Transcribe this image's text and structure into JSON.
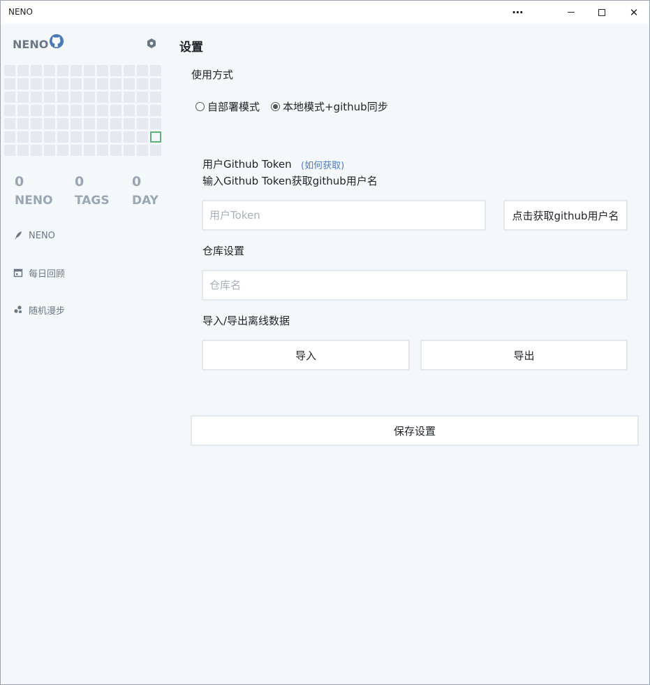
{
  "window": {
    "title": "NENO",
    "more_glyph": "⋯",
    "close_glyph": "✕"
  },
  "sidebar": {
    "brand": "NENO",
    "heatmap": {
      "rows": 7,
      "cols": 12,
      "today_row": 5,
      "today_col": 11
    },
    "stats": [
      {
        "value": "0",
        "label": "NENO"
      },
      {
        "value": "0",
        "label": "TAGS"
      },
      {
        "value": "0",
        "label": "DAY"
      }
    ],
    "nav": [
      {
        "label": "NENO",
        "icon": "feather-icon"
      },
      {
        "label": "每日回顾",
        "icon": "calendar-icon"
      },
      {
        "label": "随机漫步",
        "icon": "random-dots-icon"
      }
    ]
  },
  "main": {
    "title": "设置",
    "usage_label": "使用方式",
    "modes": [
      {
        "label": "自部署模式",
        "selected": false
      },
      {
        "label": "本地模式+github同步",
        "selected": true
      }
    ],
    "token_label": "用户Github Token",
    "token_help_link": "(如何获取)",
    "token_hint": "输入Github Token获取github用户名",
    "token_placeholder": "用户Token",
    "fetch_username_button": "点击获取github用户名",
    "repo_label": "仓库设置",
    "repo_placeholder": "仓库名",
    "import_export_label": "导入/导出离线数据",
    "import_button": "导入",
    "export_button": "导出",
    "save_button": "保存设置"
  },
  "colors": {
    "background": "#f5f8fb",
    "heatmap_empty": "#e6eaf0",
    "heatmap_today_border": "#5cb07a",
    "muted_text": "#9aa6b4",
    "link": "#4a7ab8"
  }
}
